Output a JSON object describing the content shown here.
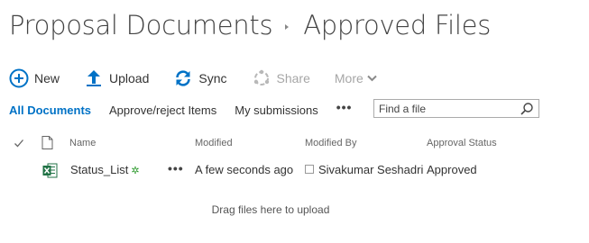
{
  "breadcrumb": {
    "site": "Proposal Documents",
    "library": "Approved Files"
  },
  "toolbar": {
    "new_label": "New",
    "upload_label": "Upload",
    "sync_label": "Sync",
    "share_label": "Share",
    "more_label": "More"
  },
  "views": {
    "tabs": [
      {
        "label": "All Documents",
        "active": true
      },
      {
        "label": "Approve/reject Items",
        "active": false
      },
      {
        "label": "My submissions",
        "active": false
      }
    ],
    "more": "•••"
  },
  "search": {
    "placeholder": "Find a file",
    "value": ""
  },
  "table": {
    "headers": {
      "name": "Name",
      "modified": "Modified",
      "modified_by": "Modified By",
      "approval_status": "Approval Status"
    },
    "rows": [
      {
        "name": "Status_List",
        "new_badge": "✲",
        "actions": "•••",
        "modified": "A few seconds ago",
        "modified_by": "Sivakumar Seshadri",
        "approval_status": "Approved",
        "file_icon": "excel-icon"
      }
    ]
  },
  "drop_hint": "Drag files here to upload",
  "colors": {
    "accent": "#0072c6",
    "excel_green": "#207245",
    "new_badge_green": "#2e9a2e",
    "disabled": "#a6a6a6"
  }
}
